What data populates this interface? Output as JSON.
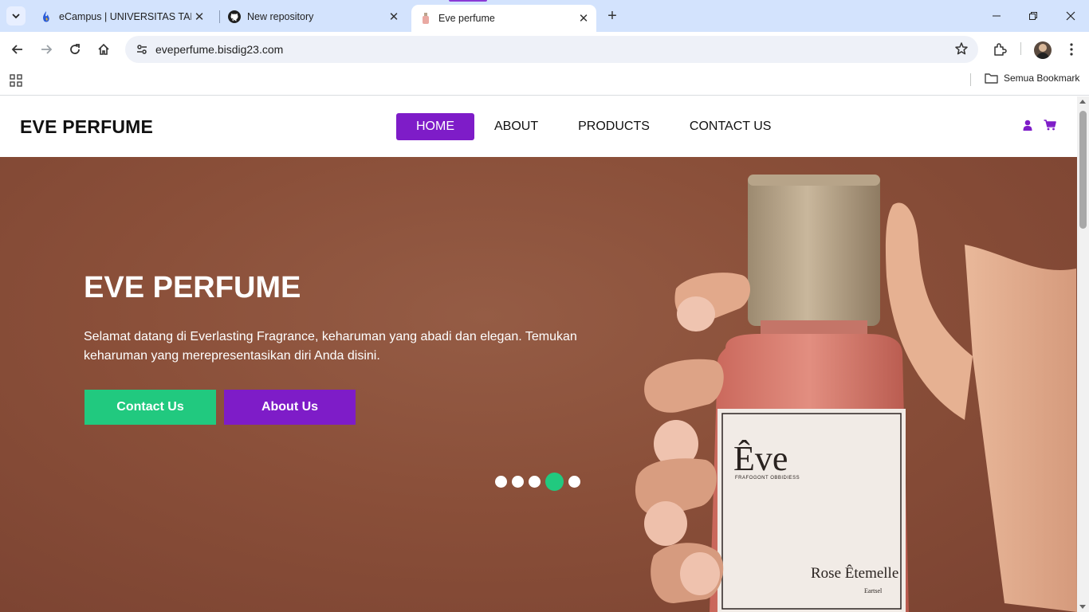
{
  "browser": {
    "tabs": [
      {
        "title": "eCampus | UNIVERSITAS TANGERANG RAYA",
        "favicon": "ecampus-flame-icon"
      },
      {
        "title": "New repository",
        "favicon": "github-icon"
      },
      {
        "title": "Eve perfume",
        "favicon": "perfume-bottle-icon",
        "active": true
      }
    ],
    "url": "eveperfume.bisdig23.com",
    "bookmarks_all_label": "Semua Bookmark"
  },
  "site": {
    "logo": "EVE PERFUME",
    "menu": [
      {
        "label": "HOME",
        "active": true
      },
      {
        "label": "ABOUT"
      },
      {
        "label": "PRODUCTS"
      },
      {
        "label": "CONTACT US"
      }
    ],
    "icons": [
      "user-icon",
      "cart-icon"
    ],
    "accent_purple": "#7e1cc8",
    "accent_green": "#21c97f"
  },
  "hero": {
    "title": "EVE PERFUME",
    "text": "Selamat datang di Everlasting Fragrance, keharuman yang abadi dan elegan. Temukan keharuman yang merepresentasikan diri Anda disini.",
    "buttons": {
      "contact": "Contact Us",
      "about": "About Us"
    },
    "carousel": {
      "count": 5,
      "active_index": 3
    },
    "bottle_label": {
      "brand": "Êve",
      "subtitle": "FRAFOGONT OBBIDIESS",
      "name": "Rose Êtemelle",
      "type": "Eartsel"
    }
  }
}
